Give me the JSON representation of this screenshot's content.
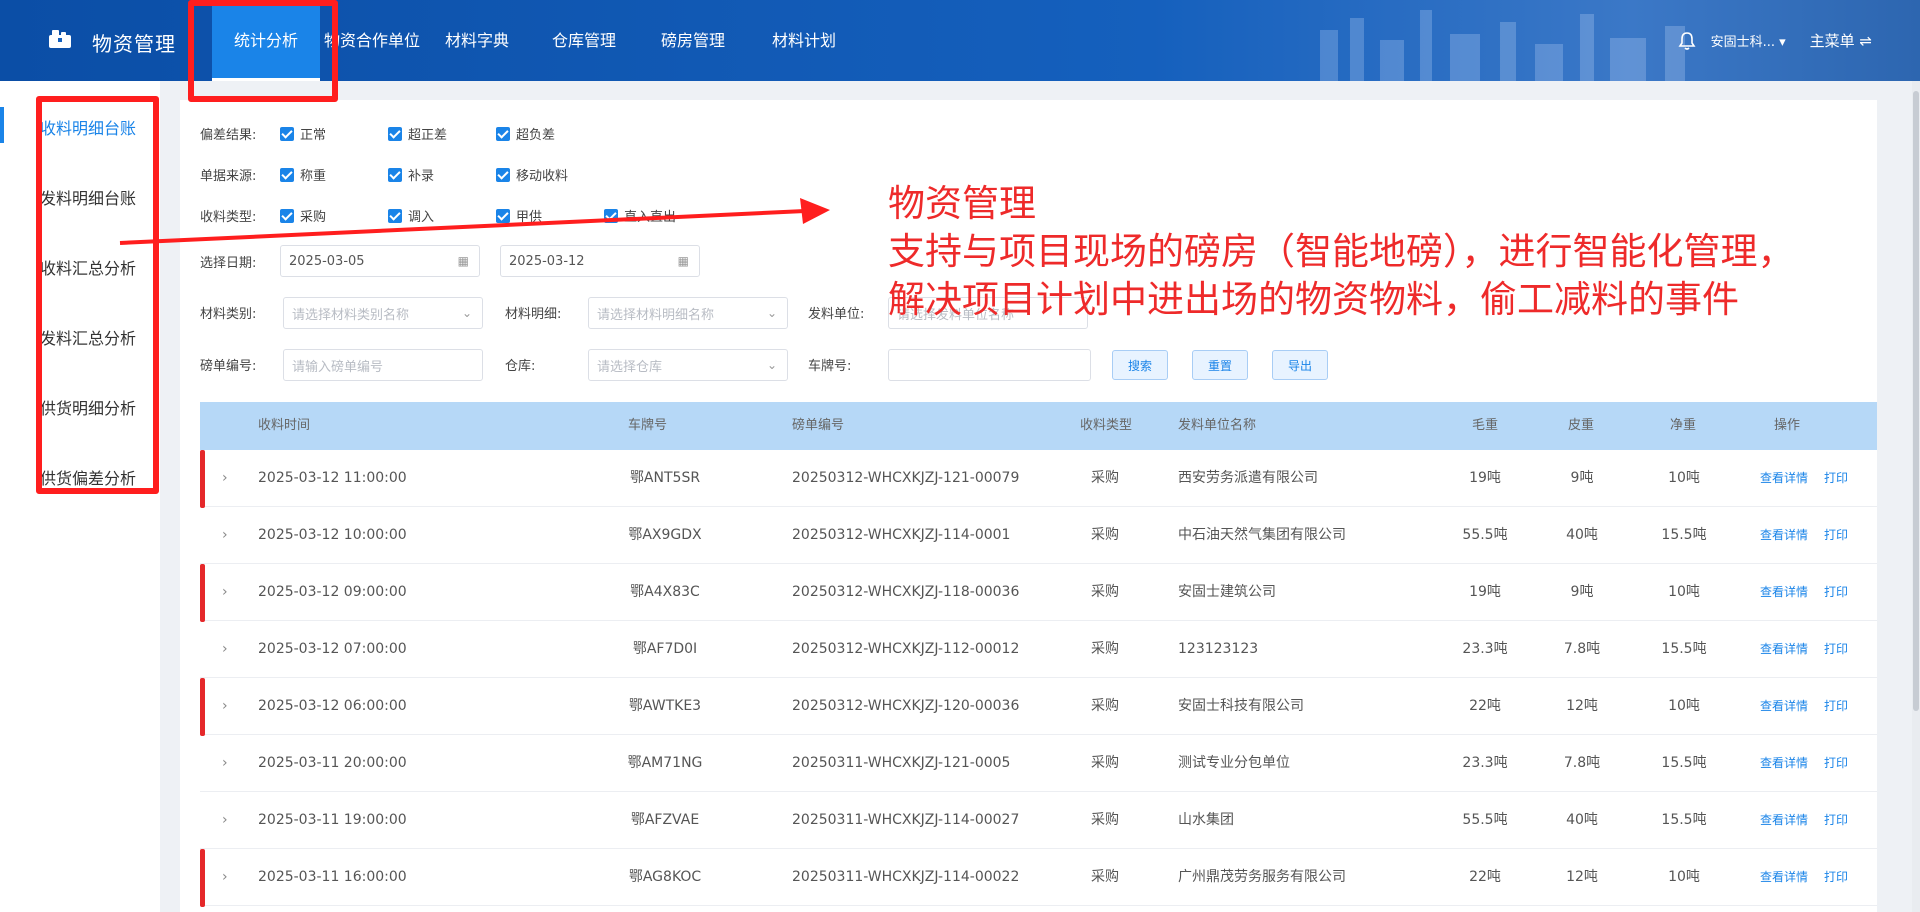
{
  "header": {
    "app_title": "物资管理",
    "nav": [
      {
        "label": "统计分析",
        "active": true
      },
      {
        "label": "物资合作单位",
        "active": false
      },
      {
        "label": "材料字典",
        "active": false
      },
      {
        "label": "仓库管理",
        "active": false
      },
      {
        "label": "磅房管理",
        "active": false
      },
      {
        "label": "材料计划",
        "active": false
      }
    ],
    "user": "安固士科...",
    "main_menu": "主菜单 ⇌"
  },
  "sidebar": {
    "items": [
      {
        "label": "收料明细台账",
        "active": true
      },
      {
        "label": "发料明细台账",
        "active": false
      },
      {
        "label": "收料汇总分析",
        "active": false
      },
      {
        "label": "发料汇总分析",
        "active": false
      },
      {
        "label": "供货明细分析",
        "active": false
      },
      {
        "label": "供货偏差分析",
        "active": false
      }
    ]
  },
  "filters": {
    "deviation_label": "偏差结果:",
    "deviation_options": [
      "正常",
      "超正差",
      "超负差"
    ],
    "source_label": "单据来源:",
    "source_options": [
      "称重",
      "补录",
      "移动收料"
    ],
    "type_label": "收料类型:",
    "type_options": [
      "采购",
      "调入",
      "甲供",
      "直入直出"
    ],
    "date_label": "选择日期:",
    "date_start": "2025-03-05",
    "date_end": "2025-03-12",
    "category_label": "材料类别:",
    "category_placeholder": "请选择材料类别名称",
    "detail_label": "材料明细:",
    "detail_placeholder": "请选择材料明细名称",
    "supplier_label": "发料单位:",
    "supplier_placeholder": "请选择发料单位名称",
    "ticket_label": "磅单编号:",
    "ticket_placeholder": "请输入磅单编号",
    "warehouse_label": "仓库:",
    "warehouse_placeholder": "请选择仓库",
    "plate_label": "车牌号:",
    "search_btn": "搜索",
    "reset_btn": "重置",
    "export_btn": "导出"
  },
  "table": {
    "headers": [
      "收料时间",
      "车牌号",
      "磅单编号",
      "收料类型",
      "发料单位名称",
      "毛重",
      "皮重",
      "净重",
      "操作"
    ],
    "action_view": "查看详情",
    "action_print": "打印",
    "rows": [
      {
        "time": "2025-03-12 11:00:00",
        "plate": "鄂ANT5SR",
        "ticket": "20250312-WHCXKJZJ-121-00079",
        "type": "采购",
        "supplier": "西安劳务派遣有限公司",
        "gross": "19吨",
        "tare": "9吨",
        "net": "10吨",
        "flag": true
      },
      {
        "time": "2025-03-12 10:00:00",
        "plate": "鄂AX9GDX",
        "ticket": "20250312-WHCXKJZJ-114-0001",
        "type": "采购",
        "supplier": "中石油天然气集团有限公司",
        "gross": "55.5吨",
        "tare": "40吨",
        "net": "15.5吨",
        "flag": false
      },
      {
        "time": "2025-03-12 09:00:00",
        "plate": "鄂A4X83C",
        "ticket": "20250312-WHCXKJZJ-118-00036",
        "type": "采购",
        "supplier": "安固士建筑公司",
        "gross": "19吨",
        "tare": "9吨",
        "net": "10吨",
        "flag": true
      },
      {
        "time": "2025-03-12 07:00:00",
        "plate": "鄂AF7D0I",
        "ticket": "20250312-WHCXKJZJ-112-00012",
        "type": "采购",
        "supplier": "123123123",
        "gross": "23.3吨",
        "tare": "7.8吨",
        "net": "15.5吨",
        "flag": false
      },
      {
        "time": "2025-03-12 06:00:00",
        "plate": "鄂AWTKE3",
        "ticket": "20250312-WHCXKJZJ-120-00036",
        "type": "采购",
        "supplier": "安固士科技有限公司",
        "gross": "22吨",
        "tare": "12吨",
        "net": "10吨",
        "flag": true
      },
      {
        "time": "2025-03-11 20:00:00",
        "plate": "鄂AM71NG",
        "ticket": "20250311-WHCXKJZJ-121-0005",
        "type": "采购",
        "supplier": "测试专业分包单位",
        "gross": "23.3吨",
        "tare": "7.8吨",
        "net": "15.5吨",
        "flag": false
      },
      {
        "time": "2025-03-11 19:00:00",
        "plate": "鄂AFZVAE",
        "ticket": "20250311-WHCXKJZJ-114-00027",
        "type": "采购",
        "supplier": "山水集团",
        "gross": "55.5吨",
        "tare": "40吨",
        "net": "15.5吨",
        "flag": false
      },
      {
        "time": "2025-03-11 16:00:00",
        "plate": "鄂AG8KOC",
        "ticket": "20250311-WHCXKJZJ-114-00022",
        "type": "采购",
        "supplier": "广州鼎茂劳务服务有限公司",
        "gross": "22吨",
        "tare": "12吨",
        "net": "10吨",
        "flag": true
      }
    ]
  },
  "annotation": {
    "line1": "物资管理",
    "line2": "支持与项目现场的磅房（智能地磅），进行智能化管理，解决项目计划中进出场的物资物料，偷工减料的事件"
  },
  "colors": {
    "accent": "#1a84e8",
    "annotation_red": "#ff1e1e",
    "header_bg": "#0b4ea6"
  }
}
